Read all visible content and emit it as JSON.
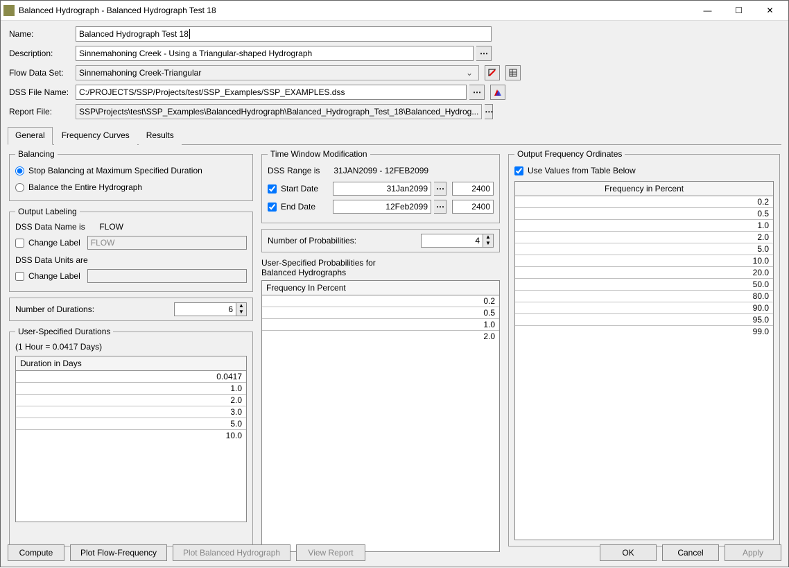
{
  "window": {
    "title": "Balanced Hydrograph -  Balanced Hydrograph Test 18",
    "minimize": "—",
    "maximize": "☐",
    "close": "✕"
  },
  "fields": {
    "name_label": "Name:",
    "name_value": "Balanced Hydrograph Test 18",
    "desc_label": "Description:",
    "desc_value": "Sinnemahoning Creek - Using a Triangular-shaped Hydrograph",
    "flowset_label": "Flow Data Set:",
    "flowset_value": "Sinnemahoning Creek-Triangular",
    "dss_label": "DSS File Name:",
    "dss_value": "C:/PROJECTS/SSP/Projects/test/SSP_Examples/SSP_EXAMPLES.dss",
    "report_label": "Report File:",
    "report_value": "SSP\\Projects\\test\\SSP_Examples\\BalancedHydrograph\\Balanced_Hydrograph_Test_18\\Balanced_Hydrog..."
  },
  "tabs": {
    "general": "General",
    "freq": "Frequency Curves",
    "results": "Results"
  },
  "balancing": {
    "legend": "Balancing",
    "opt_stop": "Stop Balancing at Maximum Specified Duration",
    "opt_entire": "Balance the Entire Hydrograph"
  },
  "output_labeling": {
    "legend": "Output Labeling",
    "dss_name_is": "DSS Data Name is",
    "dss_name_value": "FLOW",
    "change_label1": "Change Label",
    "change_value1": "FLOW",
    "dss_units_are": "DSS Data Units are",
    "change_label2": "Change Label",
    "change_value2": ""
  },
  "num_durations_label": "Number of Durations:",
  "num_durations_value": "6",
  "durations": {
    "legend": "User-Specified Durations",
    "hint": "(1 Hour = 0.0417 Days)",
    "header": "Duration in Days",
    "rows": [
      "0.0417",
      "1.0",
      "2.0",
      "3.0",
      "5.0",
      "10.0"
    ]
  },
  "time_window": {
    "legend": "Time Window Modification",
    "range_label": "DSS Range is",
    "range_value": "31JAN2099 - 12FEB2099",
    "start_label": "Start Date",
    "start_value": "31Jan2099",
    "start_time": "2400",
    "end_label": "End Date",
    "end_value": "12Feb2099",
    "end_time": "2400"
  },
  "num_prob_label": "Number of Probabilities:",
  "num_prob_value": "4",
  "user_probs": {
    "heading1": "User-Specified Probabilities for",
    "heading2": "Balanced Hydrographs",
    "header": "Frequency In Percent",
    "rows": [
      "0.2",
      "0.5",
      "1.0",
      "2.0"
    ]
  },
  "output_freq": {
    "legend": "Output Frequency Ordinates",
    "checkbox": "Use Values from Table Below",
    "header": "Frequency in Percent",
    "rows": [
      "0.2",
      "0.5",
      "1.0",
      "2.0",
      "5.0",
      "10.0",
      "20.0",
      "50.0",
      "80.0",
      "90.0",
      "95.0",
      "99.0"
    ]
  },
  "buttons": {
    "compute": "Compute",
    "plot_ff": "Plot Flow-Frequency",
    "plot_bh": "Plot Balanced Hydrograph",
    "view_report": "View Report",
    "ok": "OK",
    "cancel": "Cancel",
    "apply": "Apply"
  }
}
